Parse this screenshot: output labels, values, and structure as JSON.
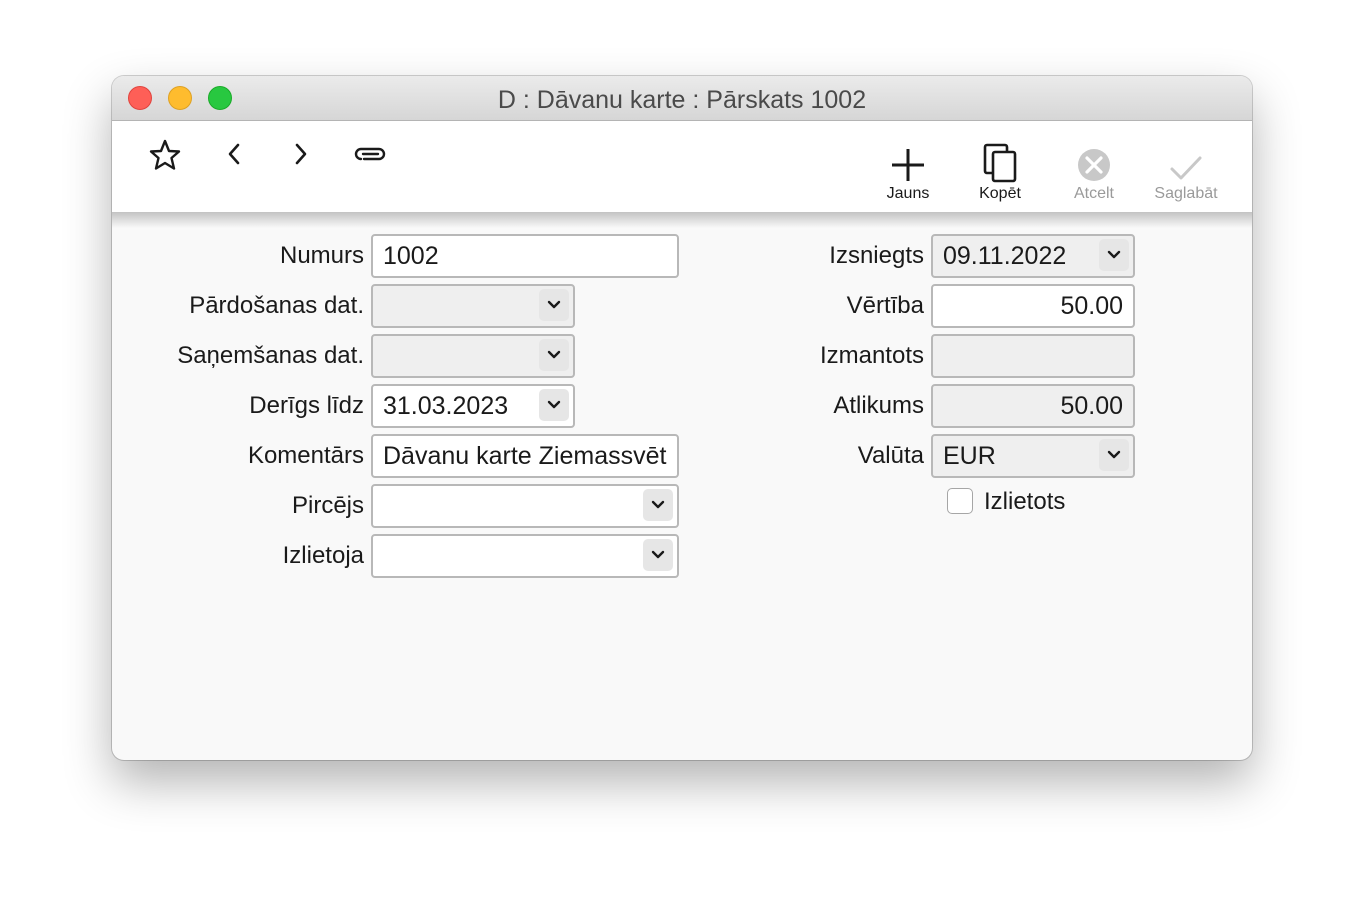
{
  "window": {
    "title": "D : Dāvanu karte : Pārskats 1002"
  },
  "toolbar": {
    "icons": [
      "star-icon",
      "chevron-left-icon",
      "chevron-right-icon",
      "paperclip-icon"
    ],
    "new_label": "Jauns",
    "copy_label": "Kopēt",
    "cancel_label": "Atcelt",
    "save_label": "Saglabāt"
  },
  "form": {
    "numurs": {
      "label": "Numurs",
      "value": "1002"
    },
    "pardosanas": {
      "label": "Pārdošanas dat.",
      "value": ""
    },
    "sanemsanas": {
      "label": "Saņemšanas dat.",
      "value": ""
    },
    "derigs": {
      "label": "Derīgs līdz",
      "value": "31.03.2023"
    },
    "komentars": {
      "label": "Komentārs",
      "value": "Dāvanu karte Ziemassvēt"
    },
    "pircejs": {
      "label": "Pircējs",
      "value": ""
    },
    "izlietoja": {
      "label": "Izlietoja",
      "value": ""
    },
    "izsniegts": {
      "label": "Izsniegts",
      "value": "09.11.2022"
    },
    "vertiba": {
      "label": "Vērtība",
      "value": "50.00"
    },
    "izmantots": {
      "label": "Izmantots",
      "value": ""
    },
    "atlikums": {
      "label": "Atlikums",
      "value": "50.00"
    },
    "valuta": {
      "label": "Valūta",
      "value": "EUR"
    },
    "izlietots": {
      "label": "Izlietots",
      "checked": false
    }
  },
  "colors": {
    "close": "#fe5f57",
    "minimize": "#febc2e",
    "maximize": "#28c840",
    "disabled": "#9a9a9a"
  }
}
